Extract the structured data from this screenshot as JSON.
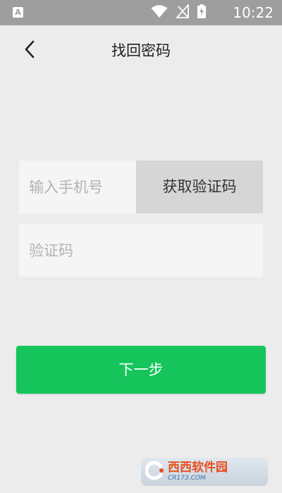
{
  "status_bar": {
    "app_icon_letter": "A",
    "time": "10:22",
    "icons": [
      "wifi-icon",
      "signal-icon",
      "battery-charging-icon"
    ]
  },
  "header": {
    "back_icon": "chevron-left-icon",
    "title": "找回密码"
  },
  "form": {
    "phone_placeholder": "输入手机号",
    "phone_value": "",
    "get_code_label": "获取验证码",
    "code_placeholder": "验证码",
    "code_value": ""
  },
  "next_button": {
    "label": "下一步"
  },
  "watermark": {
    "main_text": "西西软件园",
    "sub_text": "CR173.COM"
  },
  "colors": {
    "status_bar_bg": "#9e9e9e",
    "page_bg": "#ececec",
    "input_bg": "#f5f5f5",
    "code_button_bg": "#d6d6d6",
    "accent_green": "#15c55c"
  }
}
